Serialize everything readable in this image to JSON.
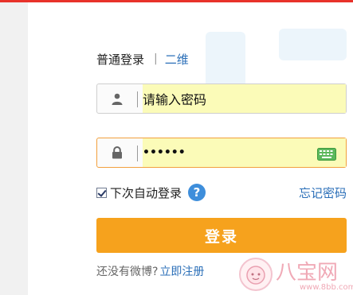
{
  "colors": {
    "accent_red": "#e8322a",
    "link_blue": "#2b6fb8",
    "button_orange": "#f6a21d",
    "autofill_yellow": "#fbfbb8",
    "focus_orange": "#f2a03d"
  },
  "tabs": {
    "normal_login": "普通登录",
    "separator": "|",
    "qr_login": "二维"
  },
  "username_field": {
    "icon": "user-icon",
    "value": "请输入密码"
  },
  "password_field": {
    "icon": "lock-icon",
    "value": "••••••",
    "keyboard_icon": "keyboard-icon"
  },
  "remember": {
    "checked": true,
    "label": "下次自动登录",
    "help_icon": "?"
  },
  "forgot_password": "忘记密码",
  "login_button": "登录",
  "register": {
    "prompt": "还没有微博?",
    "link": "立即注册"
  },
  "watermark": {
    "text": "八宝网",
    "url": "www.8bb.com"
  }
}
